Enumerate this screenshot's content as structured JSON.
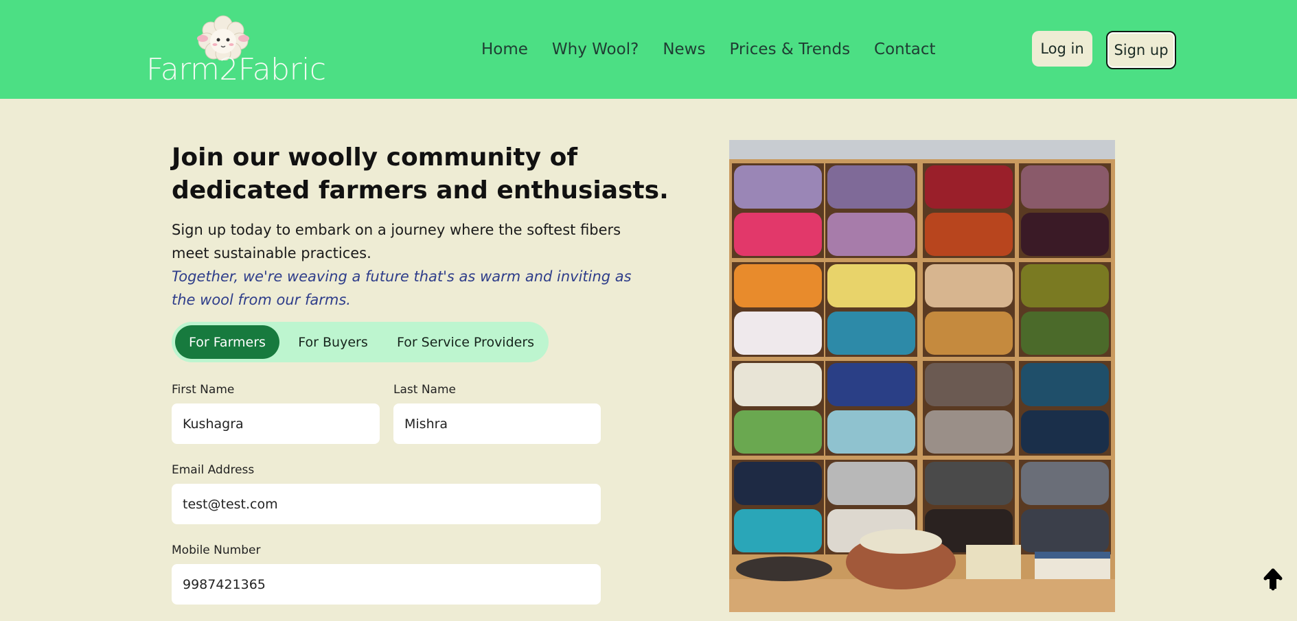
{
  "header": {
    "logo_text": "Farm2Fabric",
    "nav": [
      "Home",
      "Why Wool?",
      "News",
      "Prices & Trends",
      "Contact"
    ],
    "login_label": "Log in",
    "signup_label": "Sign up"
  },
  "hero": {
    "heading_line1": "Join our woolly community of",
    "heading_line2": "dedicated farmers and enthusiasts.",
    "intro_line1": "Sign up today to embark on a journey where the softest fibers",
    "intro_line2": "meet sustainable practices.",
    "tagline_line1": "Together, we're weaving a future that's as warm and inviting as",
    "tagline_line2": "the wool from our farms."
  },
  "tabs": [
    {
      "label": "For Farmers",
      "active": true
    },
    {
      "label": "For Buyers",
      "active": false
    },
    {
      "label": "For Service Providers",
      "active": false
    }
  ],
  "form": {
    "first_name_label": "First Name",
    "first_name_value": "Kushagra",
    "last_name_label": "Last Name",
    "last_name_value": "Mishra",
    "email_label": "Email Address",
    "email_value": "test@test.com",
    "mobile_label": "Mobile Number",
    "mobile_value": "9987421365"
  },
  "icons": {
    "logo": "sheep-icon",
    "scroll": "arrow-up-icon"
  },
  "colors": {
    "header_bg": "#4cdf84",
    "page_bg": "#eeecd4",
    "tab_active": "#177a3e",
    "tab_track": "#bdf5cf",
    "tagline": "#2e3d8a"
  }
}
